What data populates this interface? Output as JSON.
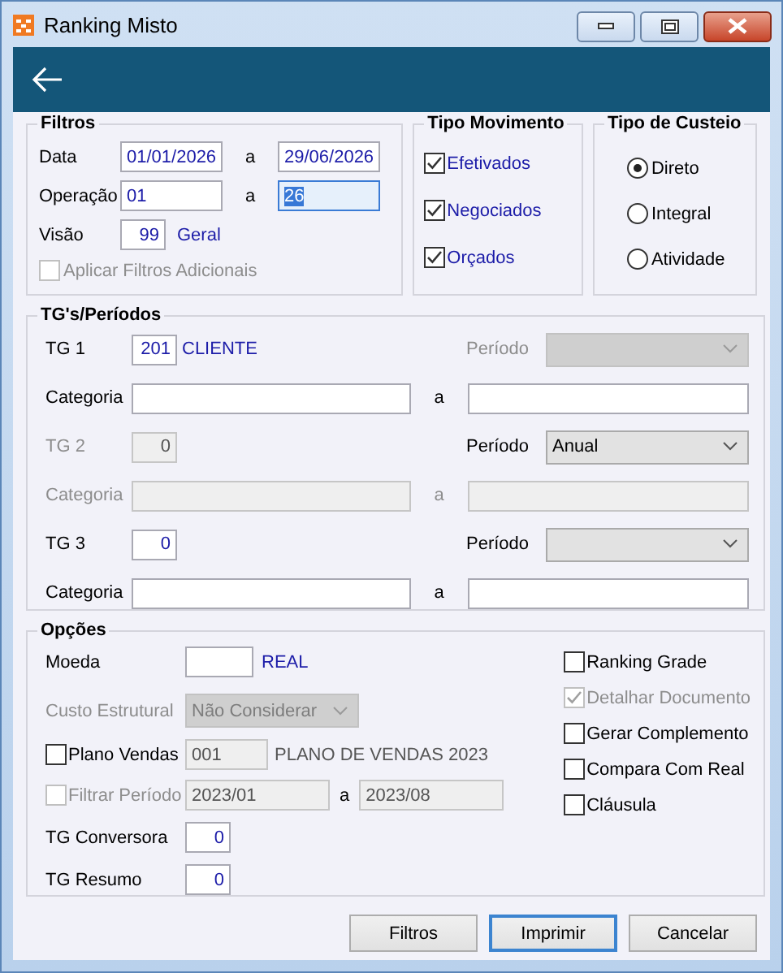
{
  "window": {
    "title": "Ranking Misto"
  },
  "filtros": {
    "title": "Filtros",
    "data": {
      "label": "Data",
      "from": "01/01/2026",
      "sep": "a",
      "to": "29/06/2026"
    },
    "operacao": {
      "label": "Operação",
      "from": "01",
      "sep": "a",
      "to": "26",
      "to_focused": true
    },
    "visao": {
      "label": "Visão",
      "value": "99",
      "name": "Geral"
    },
    "aplicar": {
      "label": "Aplicar Filtros Adicionais",
      "checked": false,
      "disabled": true
    }
  },
  "tipo_movimento": {
    "title": "Tipo Movimento",
    "options": [
      {
        "label": "Efetivados",
        "checked": true
      },
      {
        "label": "Negociados",
        "checked": true
      },
      {
        "label": "Orçados",
        "checked": true
      }
    ]
  },
  "tipo_custeio": {
    "title": "Tipo de Custeio",
    "options": [
      {
        "label": "Direto",
        "selected": true
      },
      {
        "label": "Integral",
        "selected": false
      },
      {
        "label": "Atividade",
        "selected": false
      }
    ]
  },
  "tgs": {
    "title": "TG's/Períodos",
    "groups": [
      {
        "label": "TG 1",
        "value": "201",
        "name": "CLIENTE",
        "disabled": false,
        "periodo": {
          "label": "Período",
          "disabled": true
        },
        "categoria": {
          "label": "Categoria",
          "sep": "a",
          "disabled": false
        }
      },
      {
        "label": "TG 2",
        "value": "0",
        "disabled": true,
        "periodo": {
          "label": "Período",
          "value": "Anual",
          "disabled": false
        },
        "categoria": {
          "label": "Categoria",
          "sep": "a",
          "disabled": true
        }
      },
      {
        "label": "TG 3",
        "value": "0",
        "disabled": false,
        "periodo": {
          "label": "Período",
          "disabled": false
        },
        "categoria": {
          "label": "Categoria",
          "sep": "a",
          "disabled": false
        }
      }
    ]
  },
  "opcoes": {
    "title": "Opções",
    "moeda": {
      "label": "Moeda",
      "name": "REAL"
    },
    "custo": {
      "label": "Custo Estrutural",
      "value": "Não Considerar",
      "disabled": true
    },
    "plano": {
      "label": "Plano Vendas",
      "checked": false,
      "disabled": false,
      "value": "001",
      "name": "PLANO DE VENDAS 2023"
    },
    "filtrar": {
      "label": "Filtrar Período",
      "checked": false,
      "disabled": true,
      "from": "2023/01",
      "sep": "a",
      "to": "2023/08"
    },
    "tg_conversora": {
      "label": "TG Conversora",
      "value": "0"
    },
    "tg_resumo": {
      "label": "TG Resumo",
      "value": "0"
    },
    "checks": [
      {
        "label": "Ranking Grade",
        "checked": false,
        "disabled": false
      },
      {
        "label": "Detalhar Documento",
        "checked": true,
        "disabled": true
      },
      {
        "label": "Gerar Complemento",
        "checked": false,
        "disabled": false
      },
      {
        "label": "Compara Com Real",
        "checked": false,
        "disabled": false
      },
      {
        "label": "Cláusula",
        "checked": false,
        "disabled": false
      }
    ]
  },
  "buttons": [
    {
      "label": "Filtros",
      "default": false
    },
    {
      "label": "Imprimir",
      "default": true
    },
    {
      "label": "Cancelar",
      "default": false
    }
  ]
}
